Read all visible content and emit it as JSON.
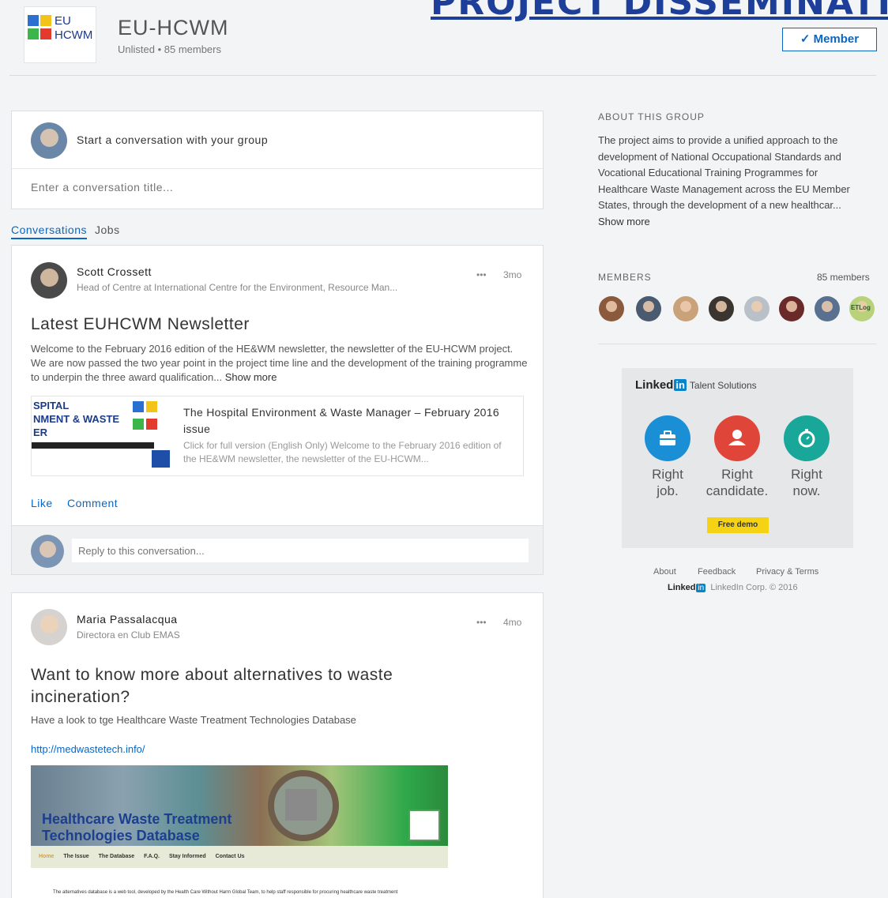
{
  "banner": {
    "text": "PROJECT DISSEMINATI"
  },
  "group": {
    "logo_line1": "EU",
    "logo_line2": "HCWM",
    "name": "EU-HCWM",
    "meta": "Unlisted  •  85 members",
    "member_button": "✓ Member"
  },
  "composer": {
    "prompt": "Start a conversation with your group",
    "title_placeholder": "Enter a conversation title..."
  },
  "tabs": [
    {
      "label": "Conversations"
    },
    {
      "label": "Jobs"
    }
  ],
  "posts": [
    {
      "author": "Scott Crossett",
      "subtitle": "Head of Centre at International Centre for the Environment, Resource Man...",
      "time": "3mo",
      "more": "•••",
      "title": "Latest EUHCWM Newsletter",
      "body": "Welcome to the February 2016 edition of the HE&WM newsletter, the newsletter of the EU-HCWM project. We are now passed the two year point in the project time line and the development of the training programme to underpin the three award qualification... ",
      "show_more": "Show more",
      "link_preview": {
        "thumb_lines": [
          "SPITAL",
          "NMENT & WASTE",
          "ER"
        ],
        "title": "The Hospital Environment & Waste Manager – February 2016 issue",
        "description": "Click for full version (English Only) Welcome to the February 2016 edition of the HE&WM newsletter, the newsletter of the EU-HCWM..."
      },
      "like": "Like",
      "comment": "Comment",
      "reply_placeholder": "Reply to this conversation..."
    },
    {
      "author": "Maria Passalacqua",
      "subtitle": "Directora en Club EMAS",
      "time": "4mo",
      "more": "•••",
      "title": "Want to know more about alternatives to waste incineration?",
      "body": "Have a look to tge Healthcare Waste Treatment Technologies Database",
      "link": "http://medwastetech.info/",
      "image": {
        "title_line1": "Healthcare Waste Treatment",
        "title_line2": "Technologies Database",
        "nav": [
          "Home",
          "The Issue",
          "The Database",
          "F.A.Q.",
          "Stay Informed",
          "Contact Us"
        ],
        "small_text": "The alternatives database is a web tool, developed by the Health Care Without Harm Global Team, to help staff responsible for procuring healthcare waste treatment"
      }
    }
  ],
  "sidebar": {
    "about_heading": "ABOUT THIS GROUP",
    "about_text": "The project aims to provide a unified approach to the development of National Occupational Standards and Vocational Educational Training Programmes for Healthcare Waste Management across the EU Member States, through the development of a new healthcar... ",
    "about_more": "Show more",
    "members_heading": "MEMBERS",
    "members_count": "85 members",
    "last_member_badge": "ETLog"
  },
  "ad": {
    "brand_word": "Linked",
    "brand_in": "in",
    "brand_sub": "Talent Solutions",
    "items": [
      {
        "line1": "Right",
        "line2": "job.",
        "color": "#1a8fd6",
        "icon": "briefcase-icon"
      },
      {
        "line1": "Right",
        "line2": "candidate.",
        "color": "#e0453a",
        "icon": "person-icon"
      },
      {
        "line1": "Right",
        "line2": "now.",
        "color": "#19a79a",
        "icon": "stopwatch-icon"
      }
    ],
    "cta": "Free demo"
  },
  "footer": {
    "links": [
      "About",
      "Feedback",
      "Privacy & Terms"
    ],
    "brand": "Linked",
    "brand_in": "in",
    "corp": "LinkedIn Corp. © 2016"
  },
  "colors": {
    "accent": "#0a66c2",
    "banner": "#1d3f9a",
    "page_bg": "#f2f4f6"
  }
}
